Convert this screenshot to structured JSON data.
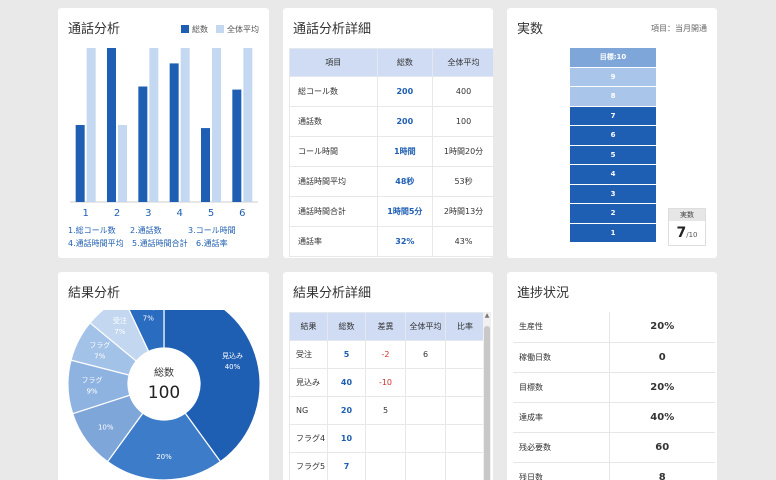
{
  "colors": {
    "primary": "#1f5fb3",
    "light": "#c5d8f2",
    "mid": "#7ea6d9"
  },
  "call_analysis": {
    "title": "通話分析",
    "legend": [
      {
        "label": "総数",
        "color": "#1f5fb3"
      },
      {
        "label": "全体平均",
        "color": "#c5d8f2"
      }
    ],
    "x_labels": [
      "1",
      "2",
      "3",
      "4",
      "5",
      "6"
    ],
    "notes": [
      "1.総コール数",
      "2.通話数",
      "3.コール時間",
      "4.通話時間平均",
      "5.通話時間合計",
      "6.通話率"
    ]
  },
  "chart_data": {
    "type": "bar",
    "categories": [
      "1",
      "2",
      "3",
      "4",
      "5",
      "6"
    ],
    "series": [
      {
        "name": "総数",
        "values": [
          50,
          100,
          75,
          90,
          48,
          73
        ]
      },
      {
        "name": "全体平均",
        "values": [
          100,
          50,
          100,
          100,
          100,
          100
        ]
      }
    ],
    "ylim": [
      0,
      100
    ]
  },
  "call_detail": {
    "title": "通話分析詳細",
    "headers": [
      "項目",
      "総数",
      "全体平均"
    ],
    "rows": [
      {
        "label": "総コール数",
        "total": "200",
        "avg": "400"
      },
      {
        "label": "通話数",
        "total": "200",
        "avg": "100"
      },
      {
        "label": "コール時間",
        "total": "1時間",
        "avg": "1時間20分"
      },
      {
        "label": "通話時間平均",
        "total": "48秒",
        "avg": "53秒"
      },
      {
        "label": "通話時間合計",
        "total": "1時間5分",
        "avg": "2時間13分"
      },
      {
        "label": "通話率",
        "total": "32%",
        "avg": "43%"
      }
    ]
  },
  "actual": {
    "title": "実数",
    "note": "項目：当月開通",
    "segments": [
      "目標:10",
      "9",
      "8",
      "7",
      "6",
      "5",
      "4",
      "3",
      "2",
      "1"
    ],
    "achieved": 7,
    "box_label": "実数",
    "box_value": "7",
    "box_total": "/10"
  },
  "result_analysis": {
    "title": "結果分析",
    "center_label": "総数",
    "center_value": "100",
    "slices": [
      {
        "label": "見込み",
        "pct": "40%",
        "value": 40,
        "color": "#1f5fb3"
      },
      {
        "label": "",
        "pct": "20%",
        "value": 20,
        "color": "#3d7cc9"
      },
      {
        "label": "",
        "pct": "10%",
        "value": 10,
        "color": "#7ea6d9"
      },
      {
        "label": "フラグ",
        "pct": "9%",
        "value": 9,
        "color": "#8fb3e0"
      },
      {
        "label": "フラグ",
        "pct": "7%",
        "value": 7,
        "color": "#a3c2e8"
      },
      {
        "label": "受注",
        "pct": "7%",
        "value": 7,
        "color": "#c3d7f0"
      },
      {
        "label": "フラグ",
        "pct": "7%",
        "value": 7,
        "color": "#2a6cc0"
      }
    ]
  },
  "result_detail": {
    "title": "結果分析詳細",
    "headers": [
      "結果",
      "総数",
      "差異",
      "全体平均",
      "比率"
    ],
    "rows": [
      {
        "label": "受注",
        "total": "5",
        "diff": "-2",
        "avg": "6",
        "ratio": ""
      },
      {
        "label": "見込み",
        "total": "40",
        "diff": "-10",
        "avg": "",
        "ratio": ""
      },
      {
        "label": "NG",
        "total": "20",
        "diff": "5",
        "avg": "",
        "ratio": ""
      },
      {
        "label": "フラグ4",
        "total": "10",
        "diff": "",
        "avg": "",
        "ratio": ""
      },
      {
        "label": "フラグ5",
        "total": "7",
        "diff": "",
        "avg": "",
        "ratio": ""
      }
    ]
  },
  "progress": {
    "title": "進捗状況",
    "rows": [
      {
        "label": "生産性",
        "value": "20%"
      },
      {
        "label": "稼働日数",
        "value": "0"
      },
      {
        "label": "目標数",
        "value": "20%"
      },
      {
        "label": "達成率",
        "value": "40%"
      },
      {
        "label": "残必要数",
        "value": "60"
      },
      {
        "label": "残日数",
        "value": "8"
      }
    ]
  }
}
